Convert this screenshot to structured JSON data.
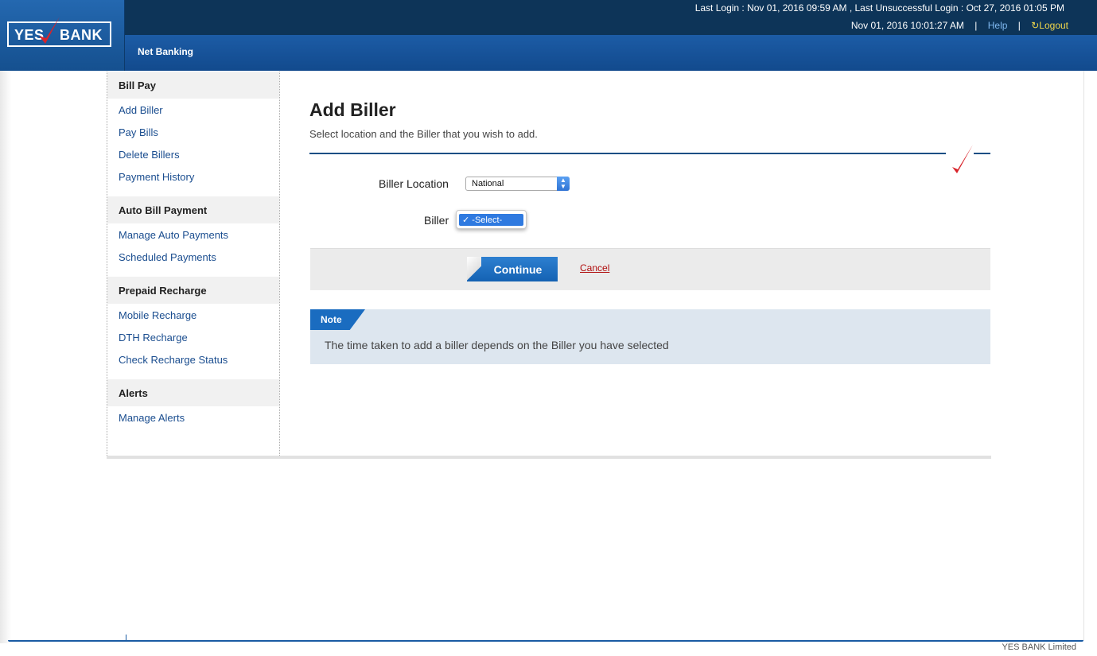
{
  "header": {
    "brand_left": "YES",
    "brand_right": "BANK",
    "last_login": "Last Login : Nov 01, 2016 09:59 AM , Last Unsuccessful Login : Oct 27, 2016 01:05 PM",
    "current_time": "Nov 01, 2016 10:01:27 AM",
    "separator": "|",
    "help": "Help",
    "logout": "Logout",
    "section": "Net Banking"
  },
  "sidebar": {
    "groups": [
      {
        "title": "Bill Pay",
        "items": [
          "Add Biller",
          "Pay Bills",
          "Delete Billers",
          "Payment History"
        ]
      },
      {
        "title": "Auto Bill Payment",
        "items": [
          "Manage Auto Payments",
          "Scheduled Payments"
        ]
      },
      {
        "title": "Prepaid Recharge",
        "items": [
          "Mobile Recharge",
          "DTH Recharge",
          "Check Recharge Status"
        ]
      },
      {
        "title": "Alerts",
        "items": [
          "Manage Alerts"
        ]
      }
    ]
  },
  "main": {
    "title": "Add Biller",
    "subtitle": "Select location and the Biller that you wish to add.",
    "location_label": "Biller Location",
    "location_value": "National",
    "biller_label": "Biller",
    "biller_value": "-Select-",
    "biller_check": "✓",
    "continue": "Continue",
    "cancel": "Cancel",
    "note_title": "Note",
    "note_text": "The time taken to add a biller depends on the Biller you have selected"
  },
  "footer": {
    "text": "YES BANK Limited"
  },
  "colors": {
    "header_dark": "#0d3458",
    "header_blue": "#1c5ca6",
    "link": "#1a4d8f",
    "cancel": "#b00d0d",
    "brand_red": "#d8232a"
  }
}
